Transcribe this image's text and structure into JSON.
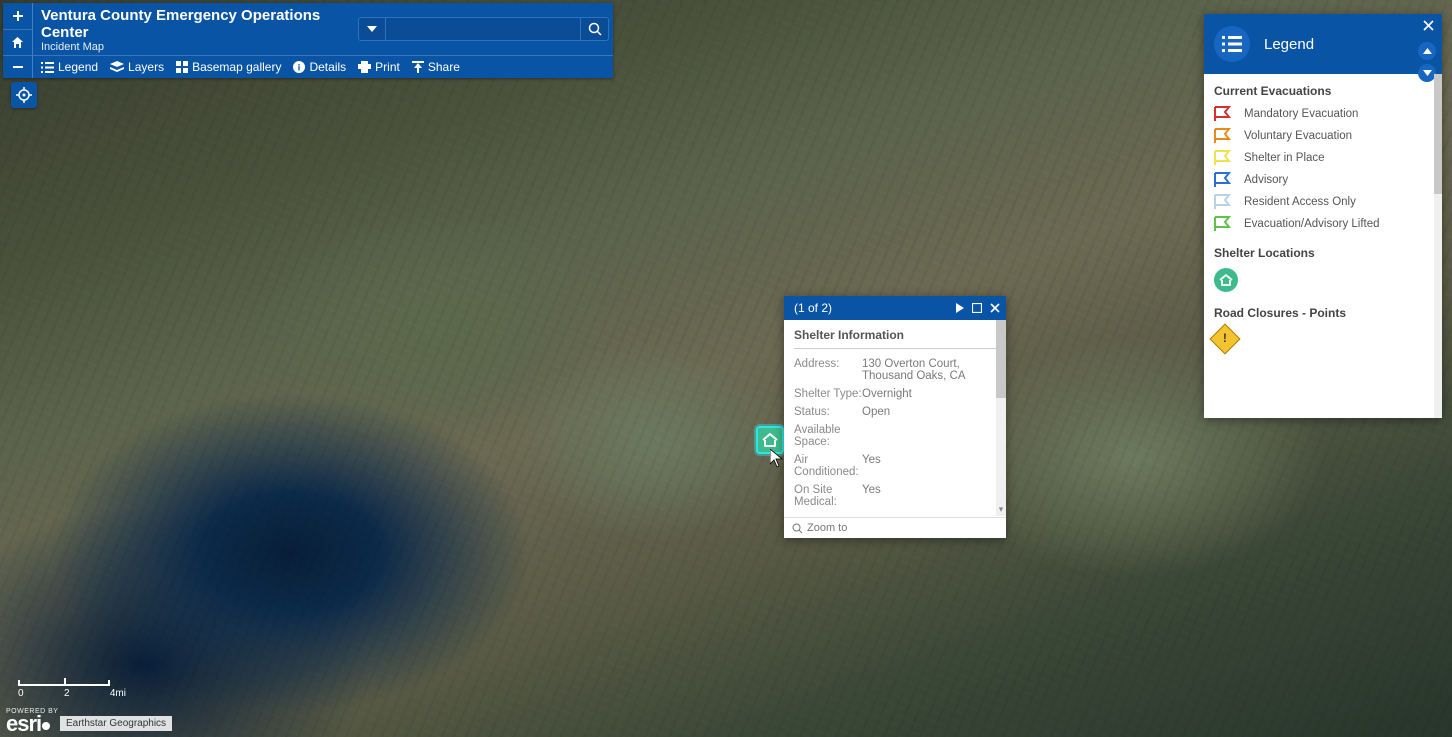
{
  "header": {
    "title": "Ventura County Emergency Operations Center",
    "subtitle": "Incident Map",
    "search_placeholder": "",
    "menu": {
      "legend": "Legend",
      "layers": "Layers",
      "basemap": "Basemap gallery",
      "details": "Details",
      "print": "Print",
      "share": "Share"
    }
  },
  "popup": {
    "pager": "(1 of 2)",
    "title": "Shelter Information",
    "rows": {
      "address_k": "Address:",
      "address_v": "130 Overton Court, Thousand Oaks, CA",
      "type_k": "Shelter Type:",
      "type_v": "Overnight",
      "status_k": "Status:",
      "status_v": "Open",
      "space_k": "Available Space:",
      "space_v": "",
      "ac_k": "Air Conditioned:",
      "ac_v": "Yes",
      "med_k": "On Site Medical:",
      "med_v": "Yes"
    },
    "zoom": "Zoom to"
  },
  "legend": {
    "title": "Legend",
    "sections": {
      "evac_title": "Current Evacuations",
      "items": {
        "mandatory": "Mandatory Evacuation",
        "voluntary": "Voluntary Evacuation",
        "shelter_in_place": "Shelter in Place",
        "advisory": "Advisory",
        "resident_access": "Resident Access Only",
        "lifted": "Evacuation/Advisory Lifted"
      },
      "shelter_title": "Shelter Locations",
      "road_title": "Road Closures - Points"
    },
    "colors": {
      "mandatory": "#d62f2f",
      "voluntary": "#e88a1a",
      "shelter_in_place": "#f1e24a",
      "advisory": "#2a6fd6",
      "resident_access": "#b9d3e6",
      "lifted": "#5fc24a"
    }
  },
  "scale": {
    "v0": "0",
    "v1": "2",
    "v2": "4mi"
  },
  "attribution": "Earthstar Geographics"
}
